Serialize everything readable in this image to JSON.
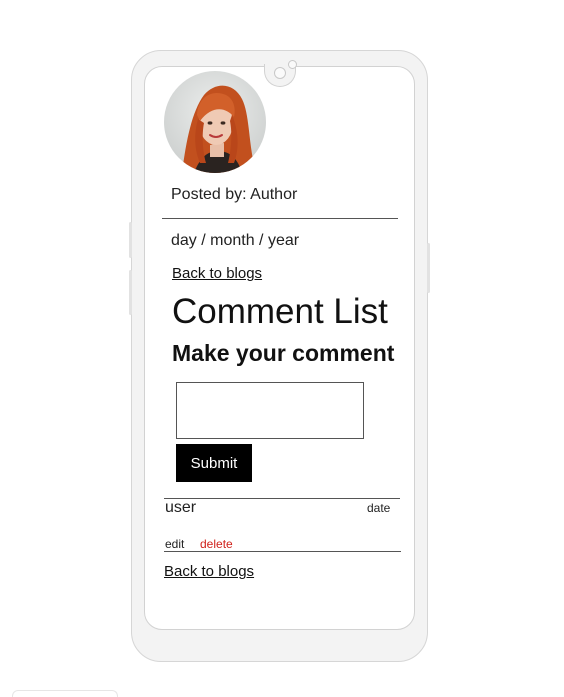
{
  "post": {
    "posted_by": "Posted by: Author",
    "date": "day / month / year",
    "back_link_top": "Back to blogs"
  },
  "comments": {
    "title": "Comment List",
    "form_heading": "Make your comment",
    "textarea_value": "",
    "submit_label": "Submit",
    "items": [
      {
        "user": "user",
        "date": "date",
        "edit_label": "edit",
        "delete_label": "delete"
      }
    ],
    "back_link_bottom": "Back to blogs"
  },
  "colors": {
    "delete": "#d0211b",
    "submit_bg": "#000000",
    "phone_frame": "#f3f3f3"
  },
  "icons": {
    "avatar": "author-avatar",
    "camera": "camera-icon"
  }
}
